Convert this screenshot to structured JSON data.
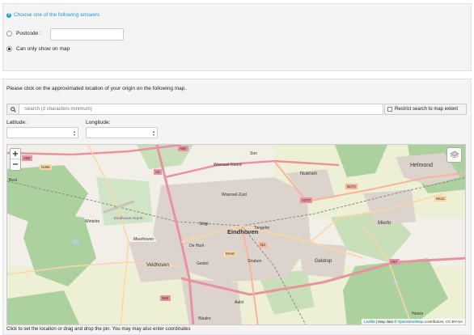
{
  "question": {
    "icon": "question-icon",
    "text": "Choose one of the following answers"
  },
  "options": [
    {
      "label": "Postcode :",
      "selected": false
    },
    {
      "label": "Can only show on map",
      "selected": true
    }
  ],
  "postcode": {
    "value": ""
  },
  "instruction": "Please click on the approximated location of your origin on the following map.",
  "search": {
    "placeholder": "Search (3 characters minimum)",
    "restrict_label": "Restrict search to map extent",
    "restrict_checked": false
  },
  "coords": {
    "latitude_label": "Latitude:",
    "latitude_value": "",
    "longitude_label": "Longitude:",
    "longitude_value": ""
  },
  "map": {
    "zoom_in": "+",
    "zoom_out": "−",
    "places": [
      "Eindhoven",
      "Woensel-Noord",
      "Woensel-Zuid",
      "Nuenen",
      "Helmond",
      "Veldhoven",
      "Geldrop",
      "Mierlo",
      "Stratum",
      "Strijp",
      "Tongelre",
      "Gestel",
      "Best",
      "Aalst",
      "Waalre",
      "Wintelre",
      "Eindhoven Airport",
      "Son",
      "De Hurk",
      "Meerhoven",
      "Heeze"
    ],
    "roads": [
      "A2",
      "A50",
      "A58",
      "A67",
      "N270",
      "A270",
      "N612",
      "N2",
      "RING",
      "N69",
      "N395"
    ],
    "attribution": {
      "leaflet": "Leaflet",
      "data": " | Map data © ",
      "osm": "OpenStreetMap",
      "rest": " contributors, CC-BY-SA"
    }
  },
  "footer": "Click to set the location or drag and drop the pin. You may may also enter coordinates",
  "colors": {
    "accent": "#1a9bd6",
    "motorway": "#e892a2",
    "trunk": "#f9b29c",
    "forest": "#add19e",
    "urban": "#d9d0c9",
    "water": "#aad3df"
  }
}
